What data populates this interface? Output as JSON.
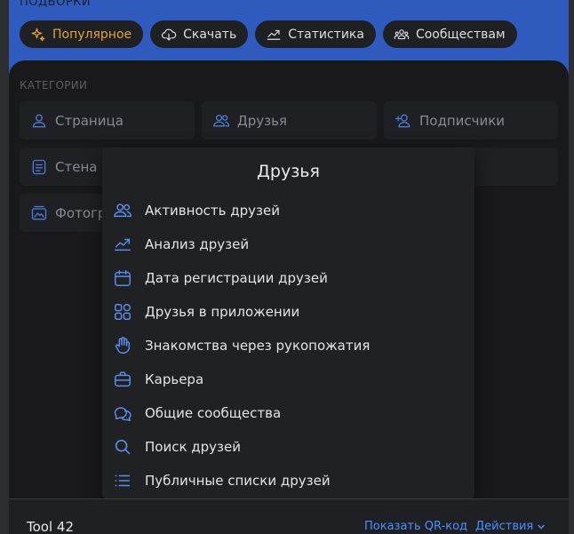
{
  "top": {
    "section_label": "ПОДБОРКИ",
    "chips": [
      {
        "label": "Популярное",
        "icon": "sparkle-icon",
        "active": true
      },
      {
        "label": "Скачать",
        "icon": "cloud-download-icon",
        "active": false
      },
      {
        "label": "Статистика",
        "icon": "chart-line-icon",
        "active": false
      },
      {
        "label": "Сообществам",
        "icon": "community-icon",
        "active": false
      }
    ]
  },
  "categories": {
    "section_label": "КАТЕГОРИИ",
    "tiles": [
      {
        "label": "Страница",
        "icon": "user-icon"
      },
      {
        "label": "Друзья",
        "icon": "users-icon"
      },
      {
        "label": "Подписчики",
        "icon": "user-add-icon"
      },
      {
        "label": "Стена",
        "icon": "wall-icon"
      },
      {
        "label": "Фотогр",
        "icon": "photo-icon"
      }
    ]
  },
  "dropdown": {
    "title": "Друзья",
    "items": [
      {
        "label": "Активность друзей",
        "icon": "users-icon"
      },
      {
        "label": "Анализ друзей",
        "icon": "chart-line-icon"
      },
      {
        "label": "Дата регистрации друзей",
        "icon": "calendar-icon"
      },
      {
        "label": "Друзья в приложении",
        "icon": "apps-icon"
      },
      {
        "label": "Знакомства через рукопожатия",
        "icon": "hand-icon"
      },
      {
        "label": "Карьера",
        "icon": "briefcase-icon"
      },
      {
        "label": "Общие сообщества",
        "icon": "chat-bubbles-icon"
      },
      {
        "label": "Поиск друзей",
        "icon": "search-icon"
      },
      {
        "label": "Публичные списки друзей",
        "icon": "list-icon"
      }
    ]
  },
  "footer": {
    "app_name": "Tool 42",
    "qr_link": "Показать QR-код",
    "separator": "·",
    "actions": "Действия"
  },
  "colors": {
    "accent_blue": "#2f5bbf",
    "link_blue": "#4a90ff",
    "icon_blue": "#5b8dee",
    "active_orange": "#e5a33a"
  }
}
